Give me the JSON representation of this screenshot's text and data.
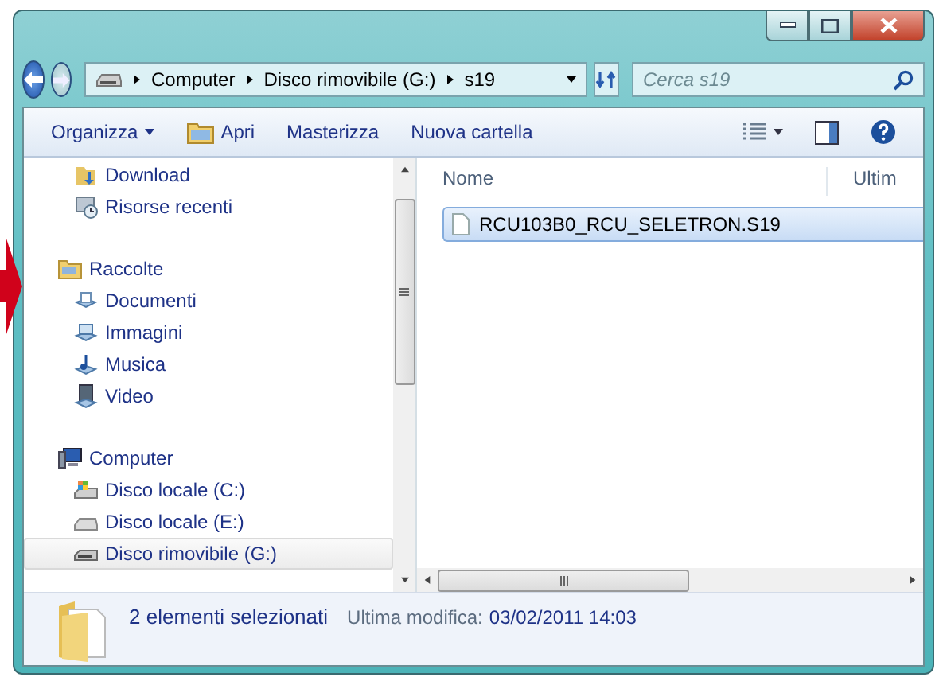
{
  "window": {
    "controls": [
      {
        "kind": "minimize"
      },
      {
        "kind": "maximize"
      },
      {
        "kind": "close"
      }
    ]
  },
  "address": {
    "crumbs": [
      "Computer",
      "Disco rimovibile (G:)",
      "s19"
    ]
  },
  "search": {
    "placeholder": "Cerca s19"
  },
  "toolbar": {
    "items": [
      {
        "label": "Organizza",
        "kind": "menu"
      },
      {
        "label": "Apri",
        "kind": "icon"
      },
      {
        "label": "Masterizza",
        "kind": "plain"
      },
      {
        "label": "Nuova cartella",
        "kind": "plain"
      }
    ]
  },
  "sidebar": {
    "sections": [
      {
        "children": [
          {
            "label": "Download",
            "kind": "download",
            "selected": false
          },
          {
            "label": "Risorse recenti",
            "kind": "recent",
            "selected": false
          }
        ]
      },
      {
        "label": "Raccolte",
        "kind": "library",
        "selected": false,
        "children": [
          {
            "label": "Documenti",
            "kind": "documents",
            "selected": false
          },
          {
            "label": "Immagini",
            "kind": "pictures",
            "selected": false
          },
          {
            "label": "Musica",
            "kind": "music",
            "selected": false
          },
          {
            "label": "Video",
            "kind": "video",
            "selected": false
          }
        ]
      },
      {
        "label": "Computer",
        "kind": "computer",
        "selected": false,
        "children": [
          {
            "label": "Disco locale (C:)",
            "kind": "system-drive",
            "selected": false
          },
          {
            "label": "Disco locale (E:)",
            "kind": "drive",
            "selected": false
          },
          {
            "label": "Disco rimovibile (G:)",
            "kind": "removable",
            "selected": true
          }
        ]
      }
    ]
  },
  "table": {
    "columns": [
      "Nome",
      "Ultim"
    ],
    "rows": [
      {
        "name": "RCU103B0_RCU_SELETRON.S19",
        "selected": true
      }
    ]
  },
  "status_bar": {
    "count": "2 elementi selezionati",
    "detail_label": "Ultima modifica:",
    "detail_value": "03/02/2011 14:03"
  }
}
